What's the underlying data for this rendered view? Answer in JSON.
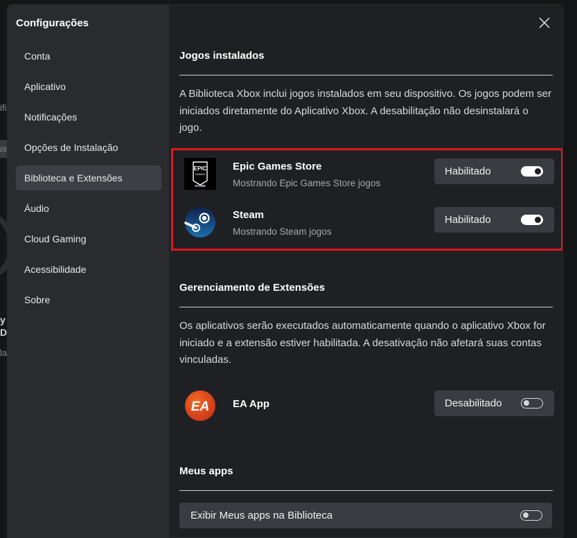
{
  "background": {
    "fragments": [
      "ifi",
      "ss",
      "y o",
      "De",
      "la"
    ]
  },
  "sidebar": {
    "title": "Configurações",
    "items": [
      {
        "label": "Conta",
        "active": false
      },
      {
        "label": "Aplicativo",
        "active": false
      },
      {
        "label": "Notificações",
        "active": false
      },
      {
        "label": "Opções de Instalação",
        "active": false
      },
      {
        "label": "Biblioteca e Extensões",
        "active": true
      },
      {
        "label": "Áudio",
        "active": false
      },
      {
        "label": "Cloud Gaming",
        "active": false
      },
      {
        "label": "Acessibilidade",
        "active": false
      },
      {
        "label": "Sobre",
        "active": false
      }
    ]
  },
  "installed_games": {
    "title": "Jogos instalados",
    "description": "A Biblioteca Xbox inclui jogos instalados em seu dispositivo. Os jogos podem ser iniciados diretamente do Aplicativo Xbox. A desabilitação não desinstalará o jogo.",
    "items": [
      {
        "name": "Epic Games Store",
        "subtitle": "Mostrando Epic Games Store jogos",
        "toggle_label": "Habilitado",
        "enabled": true,
        "logo": "epic-games-logo",
        "logo_text_top": "EPIC",
        "logo_text_mid": "GAMES",
        "logo_text_bottom": "STORE"
      },
      {
        "name": "Steam",
        "subtitle": "Mostrando Steam jogos",
        "toggle_label": "Habilitado",
        "enabled": true,
        "logo": "steam-logo"
      }
    ]
  },
  "extensions": {
    "title": "Gerenciamento de Extensões",
    "description": "Os aplicativos serão executados automaticamente quando o aplicativo Xbox for iniciado e a extensão estiver habilitada. A desativação não afetará suas contas vinculadas.",
    "items": [
      {
        "name": "EA App",
        "toggle_label": "Desabilitado",
        "enabled": false,
        "logo": "ea-logo",
        "logo_text": "EA"
      }
    ]
  },
  "my_apps": {
    "title": "Meus apps",
    "option_label": "Exibir Meus apps na Biblioteca",
    "enabled": false
  },
  "colors": {
    "highlight_border": "#e0171c",
    "ea_orange": "#e8501a",
    "steam_blue": "#1a6fb0"
  }
}
